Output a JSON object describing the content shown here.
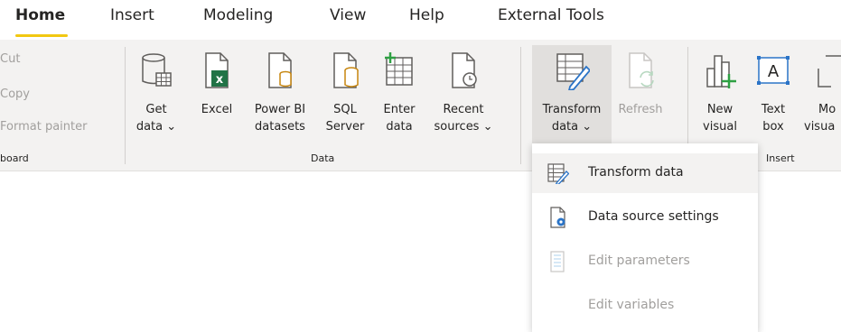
{
  "tabs": [
    {
      "label": "Home"
    },
    {
      "label": "Insert"
    },
    {
      "label": "Modeling"
    },
    {
      "label": "View"
    },
    {
      "label": "Help"
    },
    {
      "label": "External Tools"
    }
  ],
  "clipboard": {
    "cut": "Cut",
    "copy": "Copy",
    "format_painter": "Format painter",
    "group_label": "board"
  },
  "data_group": {
    "label": "Data",
    "buttons": [
      {
        "line1": "Get",
        "line2": "data ⌄"
      },
      {
        "line1": "Excel",
        "line2": ""
      },
      {
        "line1": "Power BI",
        "line2": "datasets"
      },
      {
        "line1": "SQL",
        "line2": "Server"
      },
      {
        "line1": "Enter",
        "line2": "data"
      },
      {
        "line1": "Recent",
        "line2": "sources ⌄"
      }
    ]
  },
  "queries_group": {
    "buttons": [
      {
        "line1": "Transform",
        "line2": "data ⌄"
      },
      {
        "line1": "Refresh",
        "line2": ""
      }
    ]
  },
  "insert_group": {
    "label": "Insert",
    "buttons": [
      {
        "line1": "New",
        "line2": "visual"
      },
      {
        "line1": "Text",
        "line2": "box"
      },
      {
        "line1": "Mo",
        "line2": "visua"
      }
    ]
  },
  "menu": {
    "items": [
      {
        "label": "Transform data",
        "icon": "transform-data-icon",
        "enabled": true
      },
      {
        "label": "Data source settings",
        "icon": "data-source-settings-icon",
        "enabled": true
      },
      {
        "label": "Edit parameters",
        "icon": "edit-parameters-icon",
        "enabled": false
      },
      {
        "label": "Edit variables",
        "icon": "",
        "enabled": false
      }
    ]
  },
  "colors": {
    "accent": "#f2c811",
    "excel_green": "#217346",
    "powerbi_gold": "#c7860f",
    "blue": "#2b74c7",
    "disabled": "#a19f9d"
  }
}
